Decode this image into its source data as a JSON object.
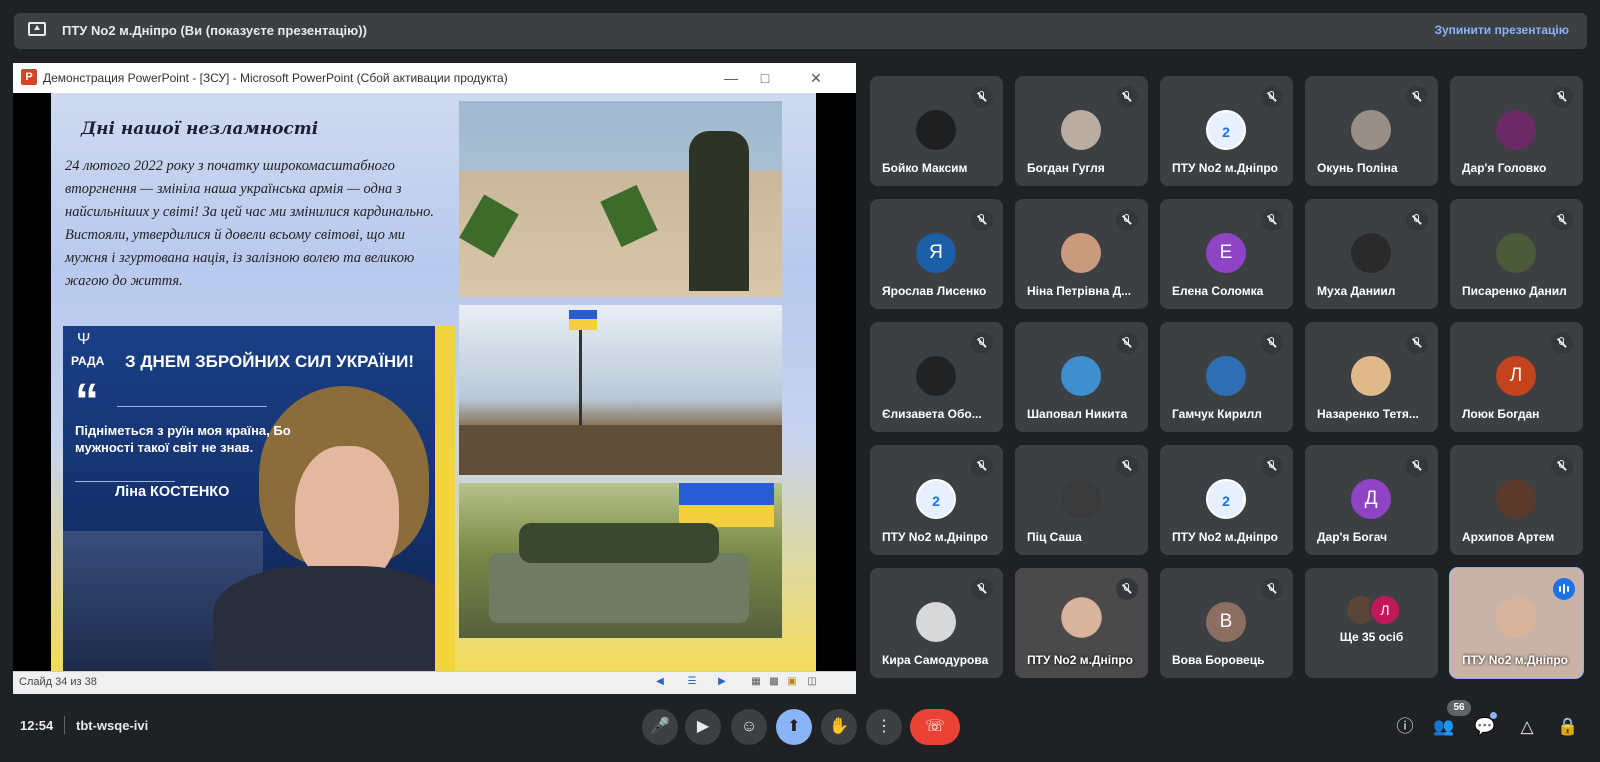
{
  "presenting_bar": {
    "text": "ПТУ No2 м.Дніпро (Ви (показуєте презентацію))",
    "stop_label": "Зупинити презентацію"
  },
  "ppt_window": {
    "icon_letter": "P",
    "title": "Демонстрация PowerPoint - [ЗСУ] - Microsoft PowerPoint (Сбой активации продукта)",
    "status": "Слайд 34 из 38"
  },
  "slide": {
    "title": "Дні нашої незламності",
    "body": "24 лютого 2022 року з початку широкомасштабного вторгнення — змінiла наша українська армія — одна з найсильніших у світі! За цей час ми змінилися кардинально. Вистояли, утвердилися й довели всьому світові, що ми мужня і згуртована нація, із залізною волею та великою жагою до життя.",
    "poster": {
      "org": "РАДА",
      "headline": "З ДНЕМ ЗБРОЙНИХ СИЛ УКРАЇНИ!",
      "quote": "Підніметься з руїн моя країна, Бо мужності такої світ не знав.",
      "author": "Ліна КОСТЕНКО"
    }
  },
  "participants": [
    {
      "name": "Бойко Максим",
      "avatar": "photo",
      "color": "#1f1f1f"
    },
    {
      "name": "Богдан Гугля",
      "avatar": "photo",
      "color": "#b9aca0"
    },
    {
      "name": "ПТУ No2 м.Дніпро",
      "avatar": "logo",
      "color": "#e8f0ff"
    },
    {
      "name": "Окунь Поліна",
      "avatar": "photo",
      "color": "#9a8f86"
    },
    {
      "name": "Дар'я Головко",
      "avatar": "photo",
      "color": "#6b2a66"
    },
    {
      "name": "Ярослав Лисенко",
      "avatar": "Я",
      "color": "#1a5fa8"
    },
    {
      "name": "Ніна Петрівна Д...",
      "avatar": "photo",
      "color": "#c99a7c"
    },
    {
      "name": "Елена Соломка",
      "avatar": "Е",
      "color": "#8e44c4"
    },
    {
      "name": "Муха Даниил",
      "avatar": "photo",
      "color": "#2a2a2a"
    },
    {
      "name": "Писаренко Данил",
      "avatar": "photo",
      "color": "#4a5a3a"
    },
    {
      "name": "Єлизавета Обо...",
      "avatar": "photo",
      "color": "#222222"
    },
    {
      "name": "Шаповал Никита",
      "avatar": "photo",
      "color": "#3f8fd0"
    },
    {
      "name": "Гамчук Кирилл",
      "avatar": "photo",
      "color": "#2d6fb2"
    },
    {
      "name": "Назаренко Тетя...",
      "avatar": "photo",
      "color": "#e0b98a"
    },
    {
      "name": "Лоюк Богдан",
      "avatar": "Л",
      "color": "#c4421c"
    },
    {
      "name": "ПТУ No2 м.Дніпро",
      "avatar": "logo",
      "color": "#e8f0ff"
    },
    {
      "name": "Піц Саша",
      "avatar": "photo",
      "color": "#3a3a3a"
    },
    {
      "name": "ПТУ No2 м.Дніпро",
      "avatar": "logo",
      "color": "#e8f0ff"
    },
    {
      "name": "Дар'я Богач",
      "avatar": "Д",
      "color": "#8e44c4"
    },
    {
      "name": "Архипов Артем",
      "avatar": "photo",
      "color": "#5a3a2a"
    },
    {
      "name": "Кира Самодурова",
      "avatar": "photo",
      "color": "#d8d8d8"
    },
    {
      "name": "ПТУ No2 м.Дніпро",
      "avatar": "video",
      "color": "#4a4a4a"
    },
    {
      "name": "Вова Боровець",
      "avatar": "В",
      "color": "#8d6e63"
    },
    {
      "name": "Ще 35 осіб",
      "avatar": "more",
      "color": "#3c4043",
      "more_initial": "Л"
    },
    {
      "name": "ПТУ No2 м.Дніпро",
      "avatar": "video",
      "color": "#c9b3a6",
      "speaking": true
    }
  ],
  "bottom_bar": {
    "time": "12:54",
    "meeting_code": "tbt-wsqe-ivi",
    "people_count": "56"
  },
  "icons": {
    "mic": "mic-icon",
    "camera": "camera-icon",
    "emoji": "emoji-icon",
    "present": "present-icon",
    "raise_hand": "hand-icon",
    "more": "more-vert-icon",
    "leave": "call-end-icon",
    "info": "info-icon",
    "people": "people-icon",
    "chat": "chat-icon",
    "activities": "activities-icon",
    "host": "lock-person-icon"
  },
  "colors": {
    "background": "#202124",
    "tile": "#3c4043",
    "accent": "#8ab4f8",
    "hangup": "#ea4335"
  }
}
